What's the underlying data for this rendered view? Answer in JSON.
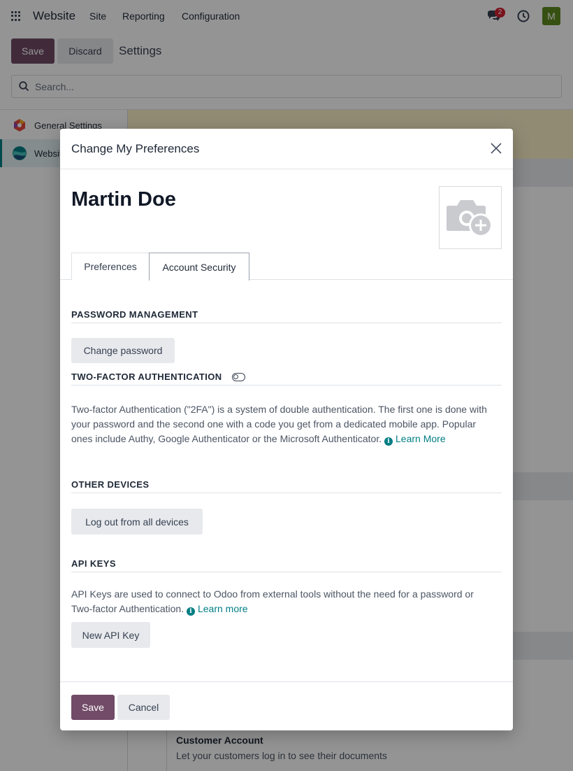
{
  "navbar": {
    "brand": "Website",
    "menu": [
      "Site",
      "Reporting",
      "Configuration"
    ],
    "chat_count": "2",
    "avatar_letter": "M"
  },
  "control_panel": {
    "save_label": "Save",
    "discard_label": "Discard",
    "title": "Settings",
    "search_placeholder": "Search..."
  },
  "sidebar": {
    "items": [
      {
        "label": "General Settings",
        "icon": "general-settings-logo"
      },
      {
        "label": "Website",
        "icon": "website-app-logo"
      }
    ]
  },
  "background": {
    "customer_title": "Customer Account",
    "customer_desc": "Let your customers log in to see their documents"
  },
  "modal": {
    "title": "Change My Preferences",
    "user_name": "Martin Doe",
    "tabs": [
      "Preferences",
      "Account Security"
    ],
    "active_tab": "Account Security",
    "password": {
      "heading": "PASSWORD MANAGEMENT",
      "button": "Change password"
    },
    "twofa": {
      "heading": "TWO-FACTOR AUTHENTICATION",
      "text": "Two-factor Authentication (\"2FA\") is a system of double authentication. The first one is done with your password and the second one with a code you get from a dedicated mobile app. Popular ones include Authy, Google Authenticator or the Microsoft Authenticator.",
      "link": "Learn More"
    },
    "devices": {
      "heading": "OTHER DEVICES",
      "button": "Log out from all devices"
    },
    "api": {
      "heading": "API KEYS",
      "text": "API Keys are used to connect to Odoo from external tools without the need for a password or Two-factor Authentication.",
      "link": "Learn more",
      "button": "New API Key"
    },
    "footer": {
      "save_label": "Save",
      "cancel_label": "Cancel"
    }
  },
  "colors": {
    "primary": "#714b67",
    "link": "#017e84",
    "badge": "#d0202f",
    "avatar": "#5d8a1e"
  }
}
